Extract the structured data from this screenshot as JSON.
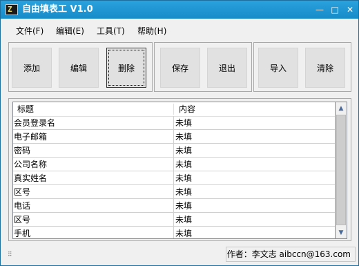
{
  "window": {
    "title": "自由填表工 V1.0",
    "icon_glyph": "Z",
    "controls": {
      "minimize": "—",
      "maximize": "□",
      "close": "✕"
    }
  },
  "menu": [
    "文件(F)",
    "编辑(E)",
    "工具(T)",
    "帮助(H)"
  ],
  "toolbar": {
    "add": "添加",
    "edit": "编辑",
    "delete": "删除",
    "save": "保存",
    "exit": "退出",
    "import": "导入",
    "clear": "清除"
  },
  "table": {
    "columns": [
      "标题",
      "内容"
    ],
    "rows": [
      [
        "会员登录名",
        "未填"
      ],
      [
        "电子邮箱",
        "未填"
      ],
      [
        "密码",
        "未填"
      ],
      [
        "公司名称",
        "未填"
      ],
      [
        "真实姓名",
        "未填"
      ],
      [
        "区号",
        "未填"
      ],
      [
        "电话",
        "未填"
      ],
      [
        "区号",
        "未填"
      ],
      [
        "手机",
        "未填"
      ]
    ]
  },
  "scrollbar": {
    "up": "▲",
    "down": "▼"
  },
  "status": {
    "author": "作者：李文志 aibccn@163.com"
  },
  "colors": {
    "titlebar": "#1d93d1",
    "button_face": "#e1e1e1"
  }
}
